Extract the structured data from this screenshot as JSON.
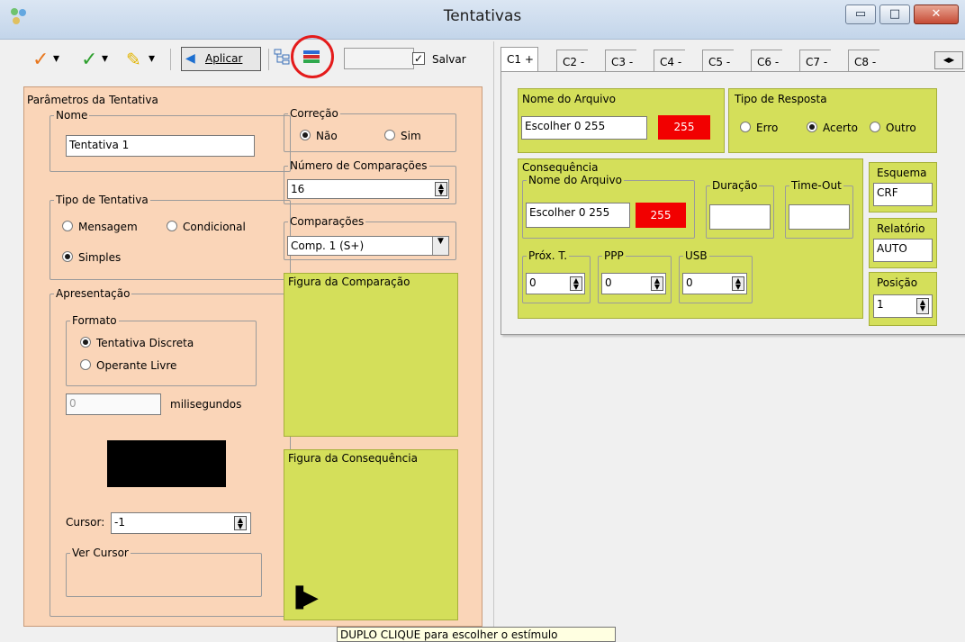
{
  "window": {
    "title": "Tentativas",
    "minimize_glyph": "▭",
    "maximize_glyph": "□",
    "close_glyph": "✕"
  },
  "toolbar": {
    "apply_label": "Aplicar",
    "save_checkbox_label": "Salvar",
    "check_glyph": "✓",
    "dropdown_glyph": "▾",
    "pencil_glyph": "✎",
    "checkbox_checked_glyph": "☑"
  },
  "trial_params": {
    "group_title": "Parâmetros da Tentativa",
    "name": {
      "legend": "Nome",
      "value": "Tentativa 1"
    },
    "type": {
      "legend": "Tipo de Tentativa",
      "options": [
        "Mensagem",
        "Condicional",
        "Simples"
      ],
      "selected": "Simples"
    },
    "presentation": {
      "legend": "Apresentação",
      "format_legend": "Formato",
      "format_options": [
        "Tentativa Discreta",
        "Operante Livre"
      ],
      "format_selected": "Tentativa Discreta",
      "ms_value": "0",
      "ms_unit": "milisegundos",
      "cursor_label": "Cursor:",
      "cursor_value": "-1",
      "ver_cursor_legend": "Ver Cursor"
    },
    "correction": {
      "legend": "Correção",
      "options": [
        "Não",
        "Sim"
      ],
      "selected": "Não"
    },
    "num_comparisons": {
      "legend": "Número de Comparações",
      "value": "16"
    },
    "comparisons": {
      "legend": "Comparações",
      "selected": "Comp. 1 (S+)"
    },
    "comparison_figure_legend": "Figura da Comparação",
    "consequence_figure_legend": "Figura da Consequência",
    "play_glyph": "▐▶"
  },
  "tabs": {
    "items": [
      "C1 +",
      "C2 -",
      "C3 -",
      "C4 -",
      "C5 -",
      "C6 -",
      "C7 -",
      "C8 -"
    ],
    "active": "C1 +",
    "scroll_left": "◀",
    "scroll_right": "▶"
  },
  "comparison_panel": {
    "file_legend": "Nome do Arquivo",
    "file_value": "Escolher 0 255",
    "color_value": "255",
    "response_legend": "Tipo de Resposta",
    "response_options": [
      "Erro",
      "Acerto",
      "Outro"
    ],
    "response_selected": "Acerto",
    "consequence_legend": "Consequência",
    "cons_file_legend": "Nome do Arquivo",
    "cons_file_value": "Escolher 0 255",
    "cons_color_value": "255",
    "duration_legend": "Duração",
    "duration_value": "",
    "timeout_legend": "Time-Out",
    "timeout_value": "",
    "next_legend": "Próx. T.",
    "next_value": "0",
    "ppp_legend": "PPP",
    "ppp_value": "0",
    "usb_legend": "USB",
    "usb_value": "0",
    "scheme_legend": "Esquema",
    "scheme_value": "CRF",
    "report_legend": "Relatório",
    "report_value": "AUTO",
    "position_legend": "Posição",
    "position_value": "1"
  },
  "tooltip": "DUPLO CLIQUE para escolher o estímulo",
  "colors": {
    "orange_panel": "#fad5b8",
    "green_panel": "#d4df5a",
    "red_swatch": "#f20000",
    "highlight_circle": "#e41b1b"
  }
}
